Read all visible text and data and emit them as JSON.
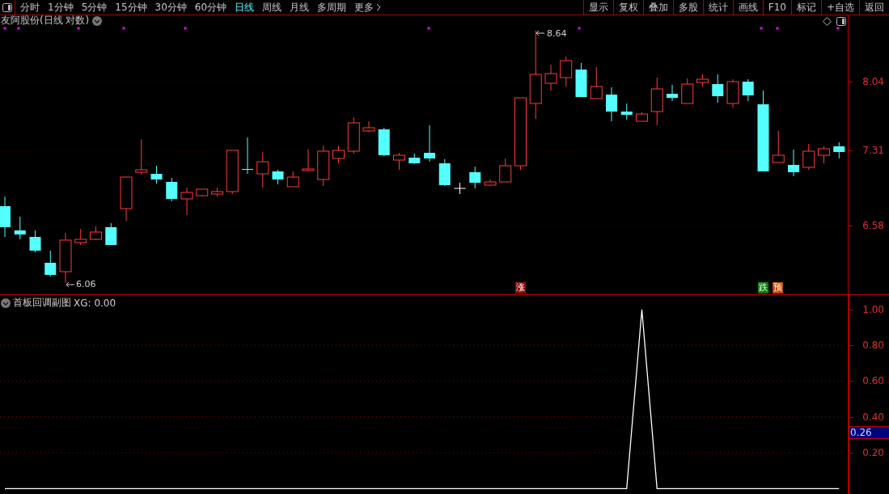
{
  "toolbar": {
    "periods": [
      {
        "label": "分时",
        "selected": false
      },
      {
        "label": "1分钟",
        "selected": false
      },
      {
        "label": "5分钟",
        "selected": false
      },
      {
        "label": "15分钟",
        "selected": false
      },
      {
        "label": "30分钟",
        "selected": false
      },
      {
        "label": "60分钟",
        "selected": false
      },
      {
        "label": "日线",
        "selected": true
      },
      {
        "label": "周线",
        "selected": false
      },
      {
        "label": "月线",
        "selected": false
      },
      {
        "label": "多周期",
        "selected": false
      },
      {
        "label": "更多",
        "selected": false
      }
    ],
    "buttons": [
      "显示",
      "复权",
      "叠加",
      "多股",
      "统计",
      "画线",
      "F10",
      "标记",
      "+自选",
      "返回"
    ]
  },
  "price_panel": {
    "title": "友阿股份(日线 对数)",
    "yticks": [
      "8.04",
      "7.31",
      "6.58"
    ],
    "high_label": "8.64",
    "low_label": "6.06",
    "signals": [
      {
        "label": "涨",
        "color": "#8a0a0a"
      },
      {
        "label": "跌",
        "color": "#0a7a0a"
      },
      {
        "label": "预",
        "color": "#c04a0a"
      }
    ]
  },
  "indicator_panel": {
    "title": "首板回调副图",
    "readout": "XG: 0.00",
    "current_value": "0.26",
    "chart_data": {
      "type": "line",
      "grid": true,
      "series": [
        {
          "color": "#ffffff",
          "values": [
            0,
            0,
            0,
            0,
            0,
            0,
            0,
            0,
            0,
            0,
            0,
            0,
            0,
            0,
            0,
            0,
            0,
            0,
            0,
            0,
            0,
            0,
            0,
            0,
            0,
            0,
            0,
            0,
            0,
            0,
            0,
            0,
            0,
            0,
            0,
            0,
            0,
            0,
            0,
            0,
            0,
            0,
            1,
            0,
            0,
            0,
            0,
            0,
            0,
            0,
            0,
            0,
            0,
            0,
            0,
            0
          ]
        }
      ],
      "ylim": [
        -0.03,
        1.08
      ],
      "yticks": [
        {
          "value": 0.2,
          "label": "0.20"
        },
        {
          "value": 0.4,
          "label": "0.40"
        },
        {
          "value": 0.6,
          "label": "0.60"
        },
        {
          "value": 0.8,
          "label": "0.80"
        },
        {
          "value": 1.0,
          "label": "1.00"
        }
      ]
    }
  }
}
